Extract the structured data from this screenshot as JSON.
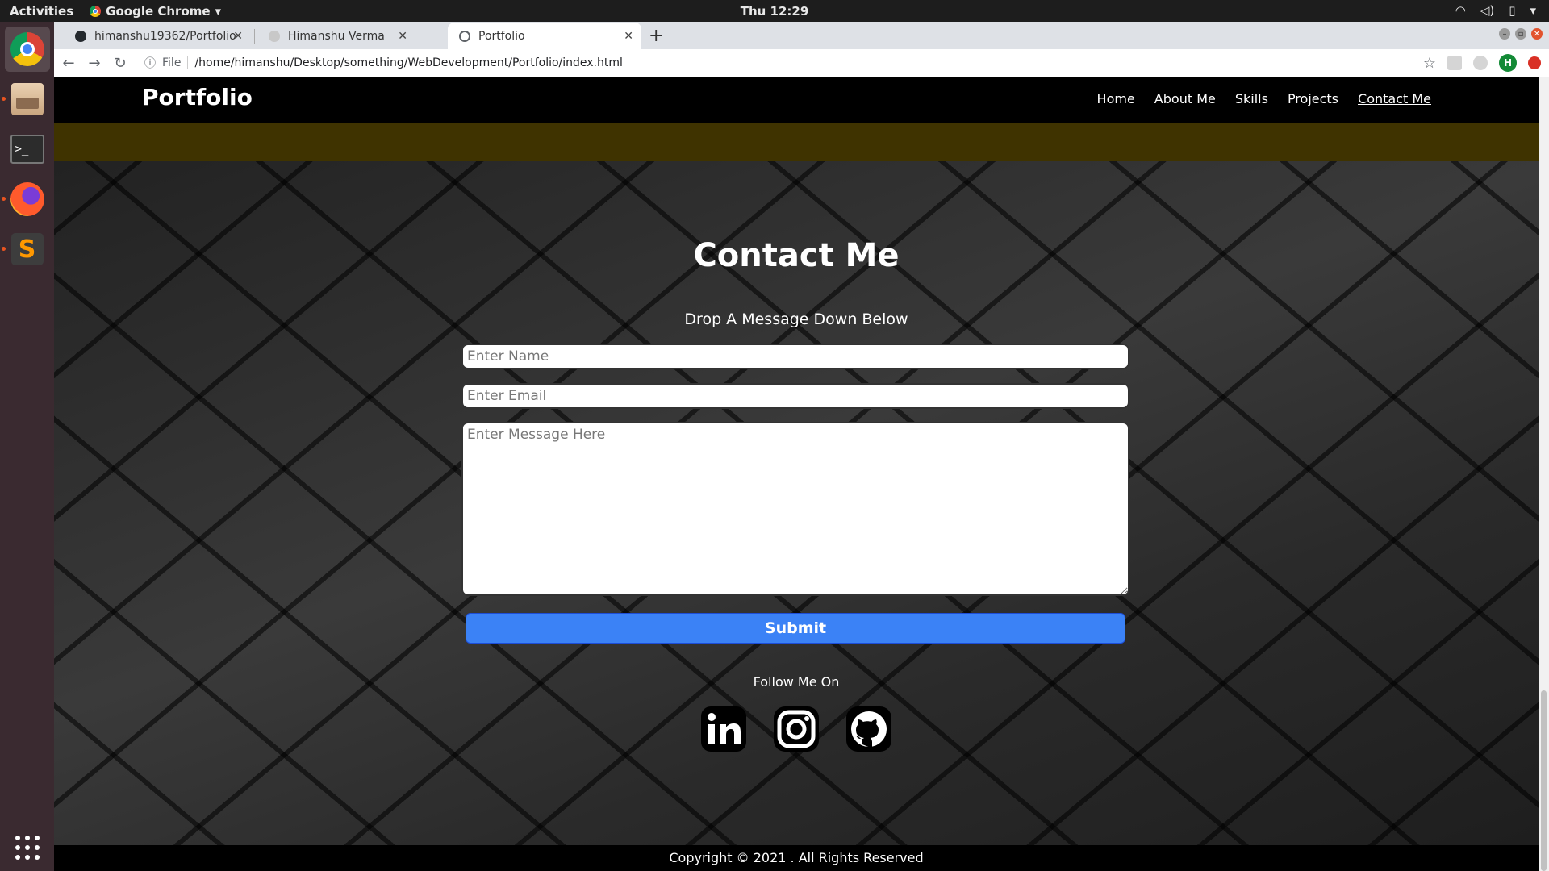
{
  "os": {
    "activities": "Activities",
    "app_name": "Google Chrome",
    "clock": "Thu 12:29"
  },
  "browser": {
    "tabs": [
      {
        "label": "himanshu19362/Portfolio"
      },
      {
        "label": "Himanshu Verma"
      },
      {
        "label": "Portfolio"
      }
    ],
    "url_scheme": "File",
    "url": "/home/himanshu/Desktop/something/WebDevelopment/Portfolio/index.html",
    "profile_initial": "H"
  },
  "site": {
    "brand": "Portfolio",
    "nav": [
      "Home",
      "About Me",
      "Skills",
      "Projects",
      "Contact Me"
    ],
    "contact_title": "Contact Me",
    "contact_subtitle": "Drop A Message Down Below",
    "name_placeholder": "Enter Name",
    "email_placeholder": "Enter Email",
    "message_placeholder": "Enter Message Here",
    "submit_label": "Submit",
    "follow_label": "Follow Me On",
    "social": [
      "linkedin-icon",
      "instagram-icon",
      "github-icon"
    ],
    "footer": "Copyright © 2021 . All Rights Reserved"
  },
  "colors": {
    "submit": "#3b82f6",
    "olive_band": "#3f3300",
    "nav_bg": "#000000"
  }
}
